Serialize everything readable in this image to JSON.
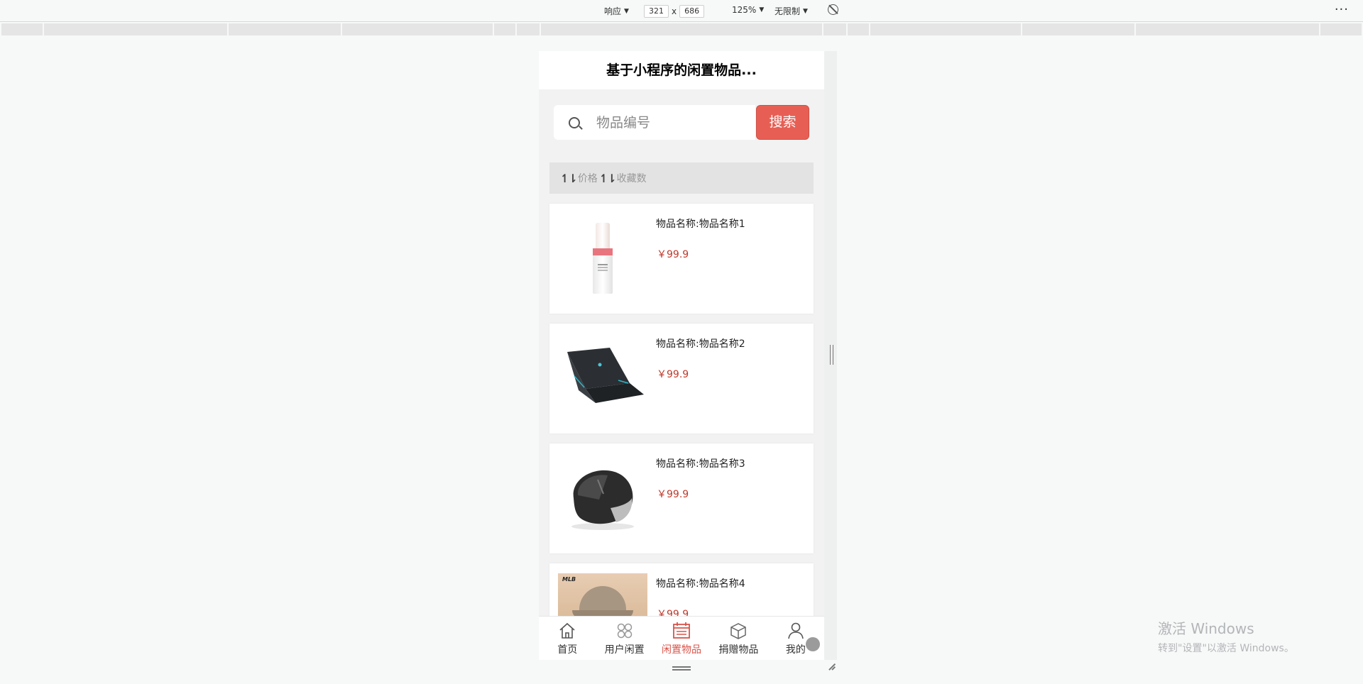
{
  "devtools": {
    "mode_label": "响应",
    "width_value": "321",
    "times_sign": "x",
    "height_value": "686",
    "zoom_label": "125%",
    "throttle_label": "无限制",
    "more_label": "···"
  },
  "header": {
    "title": "基于小程序的闲置物品..."
  },
  "search": {
    "placeholder": "物品编号",
    "value": "",
    "button_label": "搜索"
  },
  "sort": {
    "items": [
      {
        "label": "价格"
      },
      {
        "label": "收藏数"
      }
    ]
  },
  "products": [
    {
      "name": "物品名称:物品名称1",
      "price": "￥99.9",
      "image": "bottle"
    },
    {
      "name": "物品名称:物品名称2",
      "price": "￥99.9",
      "image": "laptop"
    },
    {
      "name": "物品名称:物品名称3",
      "price": "￥99.9",
      "image": "mouse"
    },
    {
      "name": "物品名称:物品名称4",
      "price": "￥99.9",
      "image": "cap-photo"
    }
  ],
  "tabbar": {
    "active_color": "#d9544a",
    "items": [
      {
        "label": "首页",
        "icon": "home-icon"
      },
      {
        "label": "用户闲置",
        "icon": "grid-icon"
      },
      {
        "label": "闲置物品",
        "icon": "calendar-icon",
        "active": true
      },
      {
        "label": "捐赠物品",
        "icon": "box-icon"
      },
      {
        "label": "我的",
        "icon": "user-icon"
      }
    ]
  },
  "watermark": {
    "title": "激活 Windows",
    "subtitle": "转到\"设置\"以激活 Windows。"
  },
  "colors": {
    "accent": "#e75f54",
    "price": "#c0392b",
    "background": "#f2f2f2"
  }
}
